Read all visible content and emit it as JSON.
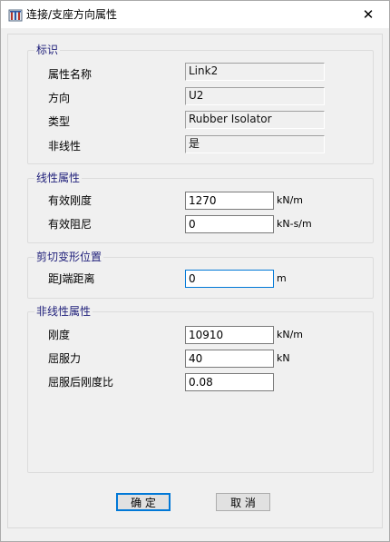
{
  "window": {
    "title": "连接/支座方向属性",
    "close_glyph": "✕"
  },
  "identification": {
    "group_title": "标识",
    "rows": [
      {
        "label": "属性名称",
        "value": "Link2"
      },
      {
        "label": "方向",
        "value": "U2"
      },
      {
        "label": "类型",
        "value": "Rubber Isolator"
      },
      {
        "label": "非线性",
        "value": "是"
      }
    ]
  },
  "linear_properties": {
    "group_title": "线性属性",
    "effective_stiffness": {
      "label": "有效刚度",
      "value": "1270",
      "unit": "kN/m"
    },
    "effective_damping": {
      "label": "有效阻尼",
      "value": "0",
      "unit": "kN-s/m"
    }
  },
  "shear_deformation": {
    "group_title": "剪切变形位置",
    "distance_from_j": {
      "label": "距J端距离",
      "value": "0",
      "unit": "m"
    }
  },
  "nonlinear_properties": {
    "group_title": "非线性属性",
    "stiffness": {
      "label": "刚度",
      "value": "10910",
      "unit": "kN/m"
    },
    "yield_strength": {
      "label": "屈服力",
      "value": "40",
      "unit": "kN"
    },
    "post_yield_ratio": {
      "label": "屈服后刚度比",
      "value": "0.08"
    }
  },
  "buttons": {
    "ok": "确 定",
    "cancel": "取 消"
  },
  "colors": {
    "accent": "#0078d7",
    "group_title": "#1f1f7a",
    "background": "#f0f0f0"
  },
  "icons": {
    "app": "sap2000-app-icon",
    "close": "close-icon"
  }
}
